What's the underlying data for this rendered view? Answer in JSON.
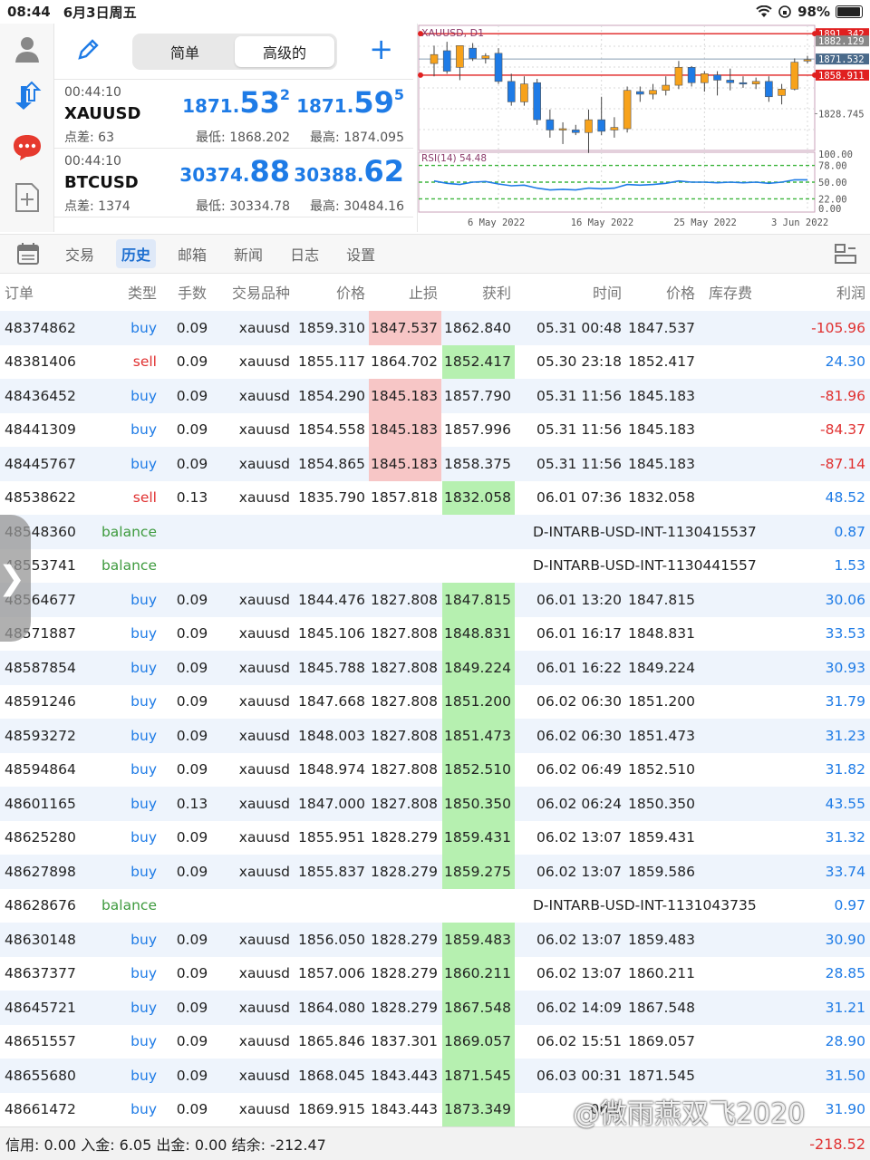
{
  "status_bar": {
    "time": "08:44",
    "date": "6月3日周五",
    "battery": "98%",
    "battery_level": 0.98
  },
  "mode": {
    "simple": "简单",
    "advanced": "高级的",
    "plus_label": "+"
  },
  "quotes": [
    {
      "time": "00:44:10",
      "symbol": "XAUUSD",
      "spread": "点差: 63",
      "bid_prefix": "1871.",
      "bid_big": "53",
      "bid_sup": "2",
      "ask_prefix": "1871.",
      "ask_big": "59",
      "ask_sup": "5",
      "low": "最低: 1868.202",
      "high": "最高: 1874.095"
    },
    {
      "time": "00:44:10",
      "symbol": "BTCUSD",
      "spread": "点差: 1374",
      "bid_prefix": "30374.",
      "bid_big": "88",
      "bid_sup": "",
      "ask_prefix": "30388.",
      "ask_big": "62",
      "ask_sup": "",
      "low": "最低: 30334.78",
      "high": "最高: 30484.16"
    }
  ],
  "chart_data": {
    "type": "candlestick",
    "title": "XAUUSD, D1",
    "indicator_label": "RSI(14) 54.48",
    "price_labels": [
      "1891.342",
      "1882.129",
      "1871.532",
      "1858.911",
      "1828.745"
    ],
    "rsi_levels": [
      "100.00",
      "78.00",
      "50.00",
      "22.00",
      "0.00"
    ],
    "x_labels": [
      "6 May 2022",
      "16 May 2022",
      "25 May 2022",
      "3 Jun 2022"
    ],
    "ylim": [
      1800,
      1895
    ],
    "candles": [
      {
        "o": 1868,
        "h": 1882,
        "l": 1858,
        "c": 1875
      },
      {
        "o": 1878,
        "h": 1885,
        "l": 1860,
        "c": 1862
      },
      {
        "o": 1865,
        "h": 1882,
        "l": 1855,
        "c": 1882
      },
      {
        "o": 1880,
        "h": 1884,
        "l": 1870,
        "c": 1872
      },
      {
        "o": 1872,
        "h": 1876,
        "l": 1868,
        "c": 1874
      },
      {
        "o": 1876,
        "h": 1880,
        "l": 1852,
        "c": 1854
      },
      {
        "o": 1854,
        "h": 1860,
        "l": 1835,
        "c": 1838
      },
      {
        "o": 1838,
        "h": 1858,
        "l": 1835,
        "c": 1852
      },
      {
        "o": 1853,
        "h": 1856,
        "l": 1820,
        "c": 1824
      },
      {
        "o": 1824,
        "h": 1832,
        "l": 1810,
        "c": 1816
      },
      {
        "o": 1816,
        "h": 1822,
        "l": 1805,
        "c": 1817
      },
      {
        "o": 1816,
        "h": 1820,
        "l": 1812,
        "c": 1814
      },
      {
        "o": 1814,
        "h": 1832,
        "l": 1798,
        "c": 1824
      },
      {
        "o": 1824,
        "h": 1842,
        "l": 1812,
        "c": 1815
      },
      {
        "o": 1816,
        "h": 1826,
        "l": 1810,
        "c": 1818
      },
      {
        "o": 1817,
        "h": 1850,
        "l": 1814,
        "c": 1847
      },
      {
        "o": 1846,
        "h": 1850,
        "l": 1838,
        "c": 1844
      },
      {
        "o": 1844,
        "h": 1852,
        "l": 1840,
        "c": 1847
      },
      {
        "o": 1847,
        "h": 1858,
        "l": 1843,
        "c": 1851
      },
      {
        "o": 1851,
        "h": 1870,
        "l": 1848,
        "c": 1865
      },
      {
        "o": 1865,
        "h": 1866,
        "l": 1850,
        "c": 1853
      },
      {
        "o": 1853,
        "h": 1862,
        "l": 1846,
        "c": 1860
      },
      {
        "o": 1859,
        "h": 1862,
        "l": 1843,
        "c": 1855
      },
      {
        "o": 1855,
        "h": 1864,
        "l": 1847,
        "c": 1853
      },
      {
        "o": 1853,
        "h": 1858,
        "l": 1849,
        "c": 1852
      },
      {
        "o": 1852,
        "h": 1857,
        "l": 1848,
        "c": 1854
      },
      {
        "o": 1854,
        "h": 1858,
        "l": 1838,
        "c": 1842
      },
      {
        "o": 1843,
        "h": 1852,
        "l": 1836,
        "c": 1848
      },
      {
        "o": 1848,
        "h": 1872,
        "l": 1847,
        "c": 1869
      },
      {
        "o": 1870,
        "h": 1874,
        "l": 1868,
        "c": 1871
      }
    ],
    "rsi": [
      52,
      48,
      46,
      50,
      51,
      47,
      44,
      45,
      40,
      37,
      38,
      37,
      40,
      39,
      40,
      46,
      45,
      46,
      48,
      52,
      50,
      50,
      49,
      50,
      49,
      50,
      48,
      50,
      54,
      54
    ],
    "colors": {
      "up": "#f7a21b",
      "down": "#1e7be6",
      "rsi": "#1e7be6",
      "level_line": "#e02020",
      "grid": "#d8d8d8",
      "dash": "#3db53d"
    }
  },
  "tabs": [
    "交易",
    "历史",
    "邮箱",
    "新闻",
    "日志",
    "设置"
  ],
  "active_tab": "历史",
  "columns": [
    "订单",
    "类型",
    "手数",
    "交易品种",
    "价格",
    "止损",
    "获利",
    "时间",
    "价格",
    "库存费",
    "利润"
  ],
  "rows": [
    {
      "order": "48374862",
      "type": "buy",
      "vol": "0.09",
      "sym": "xauusd",
      "price": "1859.310",
      "sl": "1847.537",
      "tp": "1862.840",
      "time": "05.31 00:48",
      "cprice": "1847.537",
      "swap": "",
      "profit": "-105.96",
      "hit": "sl"
    },
    {
      "order": "48381406",
      "type": "sell",
      "vol": "0.09",
      "sym": "xauusd",
      "price": "1855.117",
      "sl": "1864.702",
      "tp": "1852.417",
      "time": "05.30 23:18",
      "cprice": "1852.417",
      "swap": "",
      "profit": "24.30",
      "hit": "tp"
    },
    {
      "order": "48436452",
      "type": "buy",
      "vol": "0.09",
      "sym": "xauusd",
      "price": "1854.290",
      "sl": "1845.183",
      "tp": "1857.790",
      "time": "05.31 11:56",
      "cprice": "1845.183",
      "swap": "",
      "profit": "-81.96",
      "hit": "sl"
    },
    {
      "order": "48441309",
      "type": "buy",
      "vol": "0.09",
      "sym": "xauusd",
      "price": "1854.558",
      "sl": "1845.183",
      "tp": "1857.996",
      "time": "05.31 11:56",
      "cprice": "1845.183",
      "swap": "",
      "profit": "-84.37",
      "hit": "sl"
    },
    {
      "order": "48445767",
      "type": "buy",
      "vol": "0.09",
      "sym": "xauusd",
      "price": "1854.865",
      "sl": "1845.183",
      "tp": "1858.375",
      "time": "05.31 11:56",
      "cprice": "1845.183",
      "swap": "",
      "profit": "-87.14",
      "hit": "sl"
    },
    {
      "order": "48538622",
      "type": "sell",
      "vol": "0.13",
      "sym": "xauusd",
      "price": "1835.790",
      "sl": "1857.818",
      "tp": "1832.058",
      "time": "06.01 07:36",
      "cprice": "1832.058",
      "swap": "",
      "profit": "48.52",
      "hit": "tp"
    },
    {
      "order": "48548360",
      "type": "balance",
      "comment": "D-INTARB-USD-INT-1130415537",
      "profit": "0.87"
    },
    {
      "order": "48553741",
      "type": "balance",
      "comment": "D-INTARB-USD-INT-1130441557",
      "profit": "1.53"
    },
    {
      "order": "48564677",
      "type": "buy",
      "vol": "0.09",
      "sym": "xauusd",
      "price": "1844.476",
      "sl": "1827.808",
      "tp": "1847.815",
      "time": "06.01 13:20",
      "cprice": "1847.815",
      "swap": "",
      "profit": "30.06",
      "hit": "tp"
    },
    {
      "order": "48571887",
      "type": "buy",
      "vol": "0.09",
      "sym": "xauusd",
      "price": "1845.106",
      "sl": "1827.808",
      "tp": "1848.831",
      "time": "06.01 16:17",
      "cprice": "1848.831",
      "swap": "",
      "profit": "33.53",
      "hit": "tp"
    },
    {
      "order": "48587854",
      "type": "buy",
      "vol": "0.09",
      "sym": "xauusd",
      "price": "1845.788",
      "sl": "1827.808",
      "tp": "1849.224",
      "time": "06.01 16:22",
      "cprice": "1849.224",
      "swap": "",
      "profit": "30.93",
      "hit": "tp"
    },
    {
      "order": "48591246",
      "type": "buy",
      "vol": "0.09",
      "sym": "xauusd",
      "price": "1847.668",
      "sl": "1827.808",
      "tp": "1851.200",
      "time": "06.02 06:30",
      "cprice": "1851.200",
      "swap": "",
      "profit": "31.79",
      "hit": "tp"
    },
    {
      "order": "48593272",
      "type": "buy",
      "vol": "0.09",
      "sym": "xauusd",
      "price": "1848.003",
      "sl": "1827.808",
      "tp": "1851.473",
      "time": "06.02 06:30",
      "cprice": "1851.473",
      "swap": "",
      "profit": "31.23",
      "hit": "tp"
    },
    {
      "order": "48594864",
      "type": "buy",
      "vol": "0.09",
      "sym": "xauusd",
      "price": "1848.974",
      "sl": "1827.808",
      "tp": "1852.510",
      "time": "06.02 06:49",
      "cprice": "1852.510",
      "swap": "",
      "profit": "31.82",
      "hit": "tp"
    },
    {
      "order": "48601165",
      "type": "buy",
      "vol": "0.13",
      "sym": "xauusd",
      "price": "1847.000",
      "sl": "1827.808",
      "tp": "1850.350",
      "time": "06.02 06:24",
      "cprice": "1850.350",
      "swap": "",
      "profit": "43.55",
      "hit": "tp"
    },
    {
      "order": "48625280",
      "type": "buy",
      "vol": "0.09",
      "sym": "xauusd",
      "price": "1855.951",
      "sl": "1828.279",
      "tp": "1859.431",
      "time": "06.02 13:07",
      "cprice": "1859.431",
      "swap": "",
      "profit": "31.32",
      "hit": "tp"
    },
    {
      "order": "48627898",
      "type": "buy",
      "vol": "0.09",
      "sym": "xauusd",
      "price": "1855.837",
      "sl": "1828.279",
      "tp": "1859.275",
      "time": "06.02 13:07",
      "cprice": "1859.586",
      "swap": "",
      "profit": "33.74",
      "hit": "tp"
    },
    {
      "order": "48628676",
      "type": "balance",
      "comment": "D-INTARB-USD-INT-1131043735",
      "profit": "0.97"
    },
    {
      "order": "48630148",
      "type": "buy",
      "vol": "0.09",
      "sym": "xauusd",
      "price": "1856.050",
      "sl": "1828.279",
      "tp": "1859.483",
      "time": "06.02 13:07",
      "cprice": "1859.483",
      "swap": "",
      "profit": "30.90",
      "hit": "tp"
    },
    {
      "order": "48637377",
      "type": "buy",
      "vol": "0.09",
      "sym": "xauusd",
      "price": "1857.006",
      "sl": "1828.279",
      "tp": "1860.211",
      "time": "06.02 13:07",
      "cprice": "1860.211",
      "swap": "",
      "profit": "28.85",
      "hit": "tp"
    },
    {
      "order": "48645721",
      "type": "buy",
      "vol": "0.09",
      "sym": "xauusd",
      "price": "1864.080",
      "sl": "1828.279",
      "tp": "1867.548",
      "time": "06.02 14:09",
      "cprice": "1867.548",
      "swap": "",
      "profit": "31.21",
      "hit": "tp"
    },
    {
      "order": "48651557",
      "type": "buy",
      "vol": "0.09",
      "sym": "xauusd",
      "price": "1865.846",
      "sl": "1837.301",
      "tp": "1869.057",
      "time": "06.02 15:51",
      "cprice": "1869.057",
      "swap": "",
      "profit": "28.90",
      "hit": "tp"
    },
    {
      "order": "48655680",
      "type": "buy",
      "vol": "0.09",
      "sym": "xauusd",
      "price": "1868.045",
      "sl": "1843.443",
      "tp": "1871.545",
      "time": "06.03 00:31",
      "cprice": "1871.545",
      "swap": "",
      "profit": "31.50",
      "hit": "tp"
    },
    {
      "order": "48661472",
      "type": "buy",
      "vol": "0.09",
      "sym": "xauusd",
      "price": "1869.915",
      "sl": "1843.443",
      "tp": "1873.349",
      "time": "06.0",
      "cprice": "",
      "swap": "",
      "profit": "31.90",
      "hit": "tp"
    }
  ],
  "footer": {
    "text": "信用:  0.00 入金:  6.05 出金:  0.00 结余:  -212.47",
    "total": "-218.52"
  },
  "watermark": "@微雨燕双飞2020",
  "side_handle": "❯"
}
